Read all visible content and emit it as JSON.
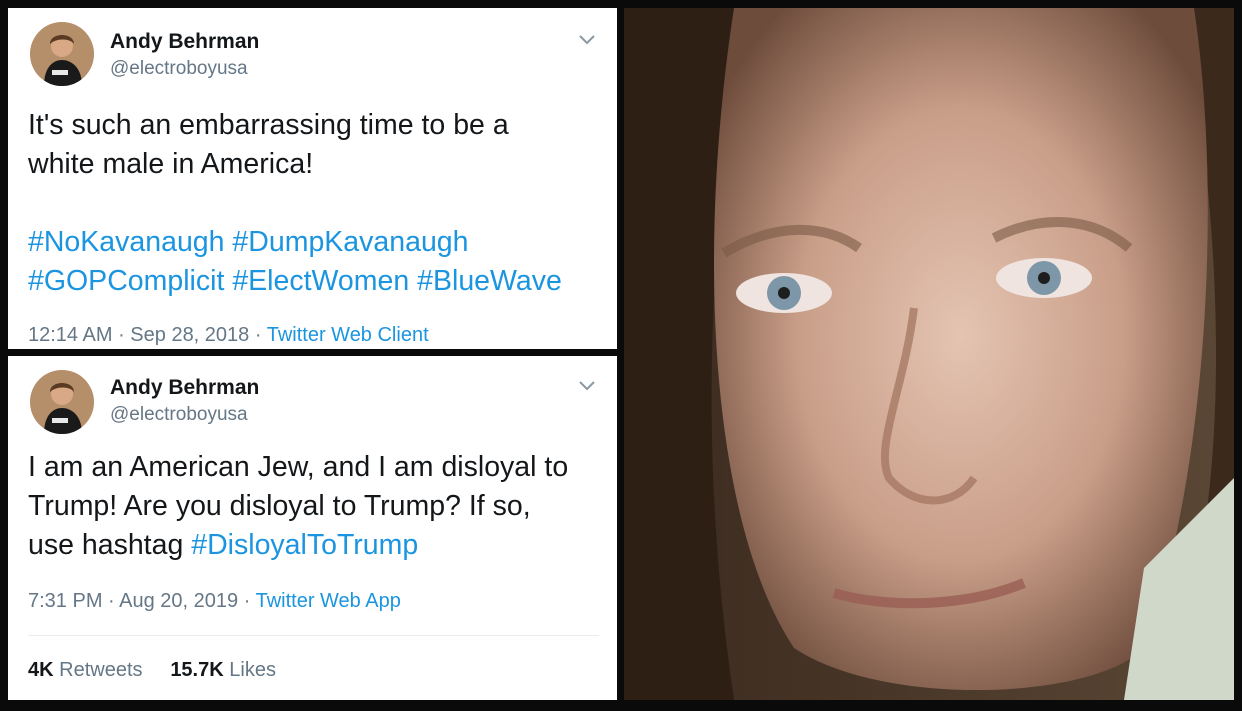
{
  "tweets": [
    {
      "display_name": "Andy Behrman",
      "handle": "@electroboyusa",
      "text_line1": "It's such an embarrassing time to be a",
      "text_line2": "white male in America!",
      "hashtags_line1": [
        "#NoKavanaugh",
        "#DumpKavanaugh"
      ],
      "hashtags_line2": [
        "#GOPComplicit",
        "#ElectWomen",
        "#BlueWave"
      ],
      "time": "12:14 AM",
      "date": "Sep 28, 2018",
      "source": "Twitter Web Client"
    },
    {
      "display_name": "Andy Behrman",
      "handle": "@electroboyusa",
      "text_line1": "I am an American Jew, and I am disloyal to",
      "text_line2": "Trump! Are you disloyal to Trump? If so,",
      "text_line3": "use hashtag ",
      "hashtag": "#DisloyalToTrump",
      "time": "7:31 PM",
      "date": "Aug 20, 2019",
      "source": "Twitter Web App",
      "retweets_count": "4K",
      "retweets_label": "Retweets",
      "likes_count": "15.7K",
      "likes_label": "Likes"
    }
  ],
  "colors": {
    "hashtag": "#1b95e0",
    "secondary_text": "#657786",
    "primary_text": "#14171a",
    "frame": "#0a0a0a"
  },
  "icons": [
    "avatar",
    "chevron-down-icon",
    "portrait-photo"
  ]
}
